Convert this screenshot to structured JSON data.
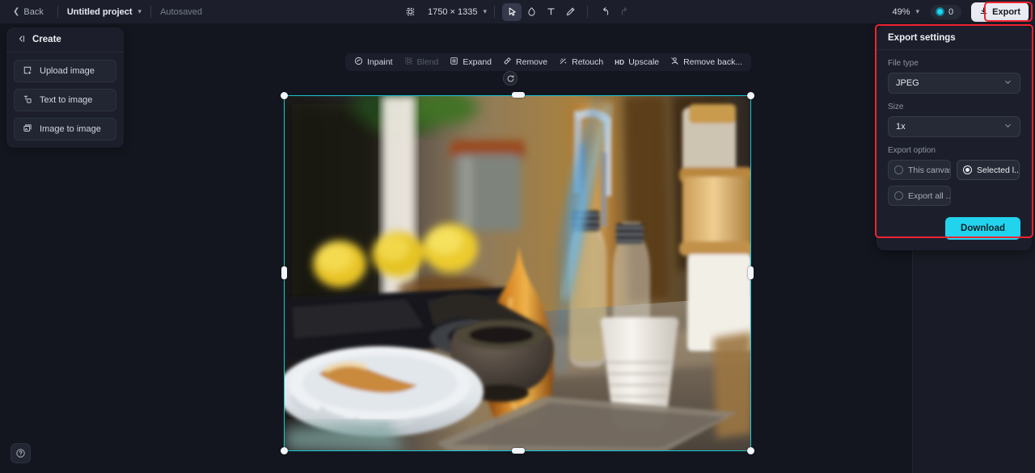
{
  "topbar": {
    "back_label": "Back",
    "project_name": "Untitled project",
    "autosave_label": "Autosaved",
    "canvas_size": "1750 × 1335",
    "zoom_level": "49%",
    "credit_count": "0",
    "export_label": "Export",
    "tools": [
      {
        "name": "canvas-resize-icon",
        "active": false,
        "disabled": false
      },
      {
        "name": "select-tool",
        "active": true,
        "disabled": false
      },
      {
        "name": "eraser-tool",
        "active": false,
        "disabled": false
      },
      {
        "name": "text-tool",
        "active": false,
        "disabled": false
      },
      {
        "name": "brush-tool",
        "active": false,
        "disabled": false
      },
      {
        "name": "undo-button",
        "active": false,
        "disabled": false
      },
      {
        "name": "redo-button",
        "active": false,
        "disabled": true
      }
    ]
  },
  "left_panel": {
    "title": "Create",
    "items": [
      {
        "label": "Upload image",
        "icon": "upload-image-icon"
      },
      {
        "label": "Text to image",
        "icon": "text-to-image-icon"
      },
      {
        "label": "Image to image",
        "icon": "image-to-image-icon"
      }
    ]
  },
  "context_toolbar": {
    "items": [
      {
        "label": "Inpaint",
        "icon": "inpaint-icon",
        "disabled": false
      },
      {
        "label": "Blend",
        "icon": "blend-icon",
        "disabled": true
      },
      {
        "label": "Expand",
        "icon": "expand-icon",
        "disabled": false
      },
      {
        "label": "Remove",
        "icon": "remove-icon",
        "disabled": false
      },
      {
        "label": "Retouch",
        "icon": "retouch-icon",
        "disabled": false
      },
      {
        "label": "Upscale",
        "icon": "upscale-icon",
        "badge": "HD",
        "disabled": false
      },
      {
        "label": "Remove back...",
        "icon": "remove-background-icon",
        "disabled": false
      }
    ]
  },
  "export_panel": {
    "title": "Export settings",
    "file_type_label": "File type",
    "file_type_value": "JPEG",
    "size_label": "Size",
    "size_value": "1x",
    "export_option_label": "Export option",
    "options": [
      {
        "label": "This canvas",
        "selected": false
      },
      {
        "label": "Selected l...",
        "selected": true
      },
      {
        "label": "Export all ...",
        "selected": false
      }
    ],
    "download_label": "Download",
    "accent_color": "#22d3ee",
    "highlight_color": "#ef2230"
  },
  "canvas": {
    "selection_color": "#17c8d4",
    "image_description": "Blurred kitchen counter scene with lemons, oil cruets, mortar and pestle, white fluted dish and wooden jars"
  },
  "help": {
    "label": "?"
  }
}
